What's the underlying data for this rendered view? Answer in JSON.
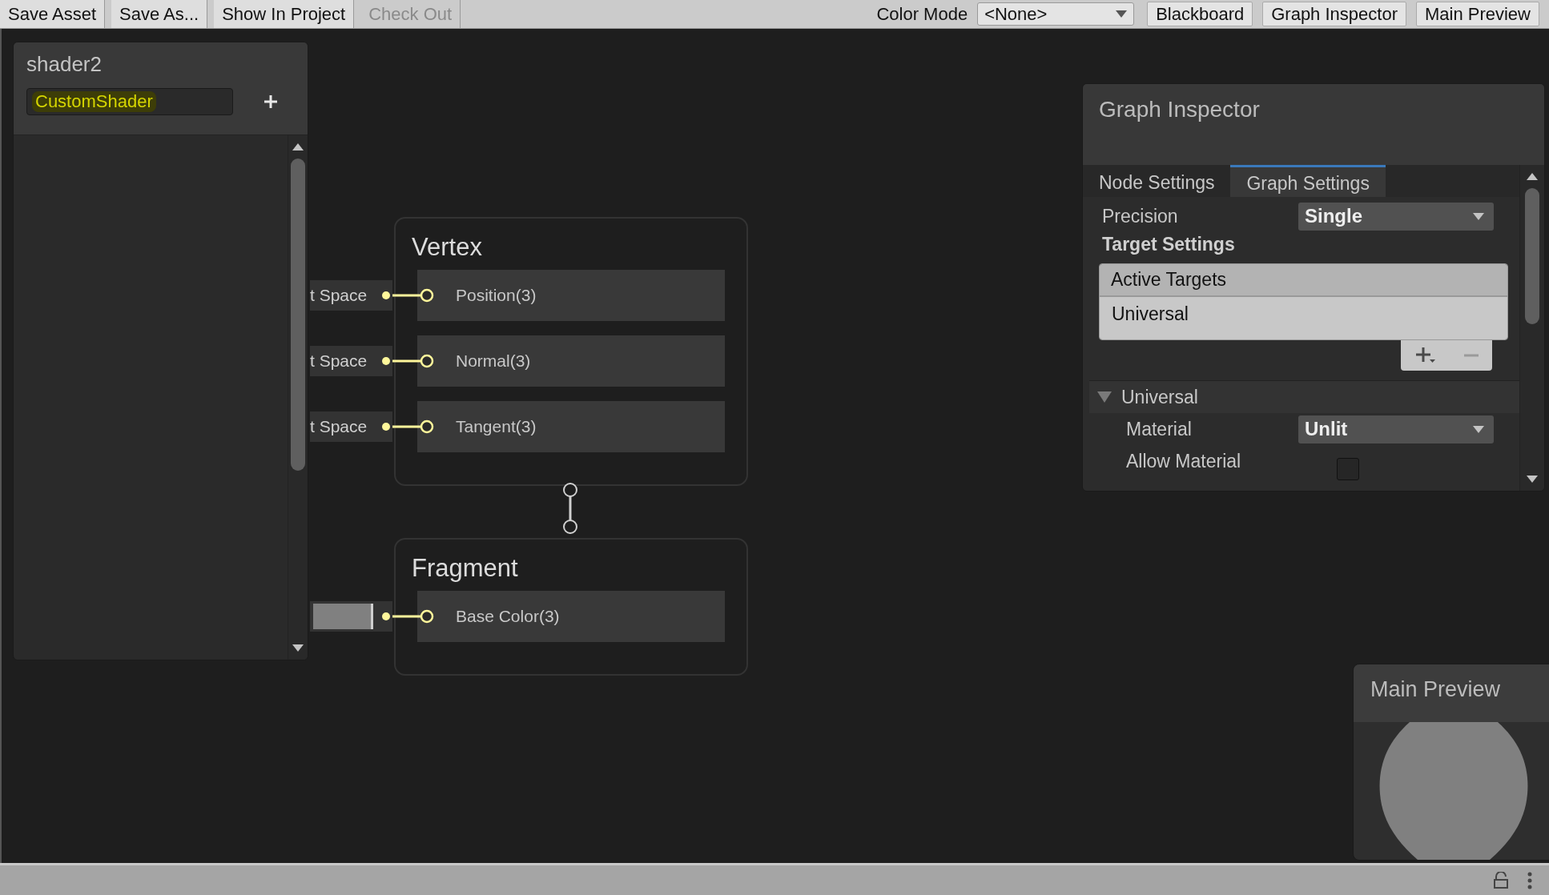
{
  "toolbar": {
    "buttons": [
      {
        "label": "Save Asset",
        "disabled": false
      },
      {
        "label": "Save As...",
        "disabled": false
      },
      {
        "label": "Show In Project",
        "disabled": false
      },
      {
        "label": "Check Out",
        "disabled": true
      }
    ],
    "color_mode": {
      "label": "Color Mode",
      "value": "<None>"
    },
    "toggles": [
      "Blackboard",
      "Graph Inspector",
      "Main Preview"
    ]
  },
  "blackboard": {
    "title": "shader2",
    "category_field": "CustomShader"
  },
  "nodes": [
    {
      "title": "Vertex",
      "ports": [
        {
          "label": "Position(3)",
          "kind": "space",
          "input": "t Space"
        },
        {
          "label": "Normal(3)",
          "kind": "space",
          "input": "t Space"
        },
        {
          "label": "Tangent(3)",
          "kind": "space",
          "input": "t Space"
        }
      ]
    },
    {
      "title": "Fragment",
      "ports": [
        {
          "label": "Base Color(3)",
          "kind": "color",
          "color": "#808080"
        }
      ]
    }
  ],
  "inspector": {
    "title": "Graph Inspector",
    "tabs": [
      {
        "label": "Node Settings",
        "selected": false
      },
      {
        "label": "Graph Settings",
        "selected": true
      }
    ],
    "precision": {
      "label": "Precision",
      "value": "Single"
    },
    "section": "Target Settings",
    "targets": {
      "header": "Active Targets",
      "items": [
        "Universal"
      ]
    },
    "group": {
      "label": "Universal",
      "expanded": true,
      "fields": [
        {
          "kind": "dropdown",
          "label": "Material",
          "value": "Unlit"
        },
        {
          "kind": "checkbox",
          "label": "Allow Material",
          "checked": false
        }
      ]
    }
  },
  "preview": {
    "title": "Main Preview"
  }
}
